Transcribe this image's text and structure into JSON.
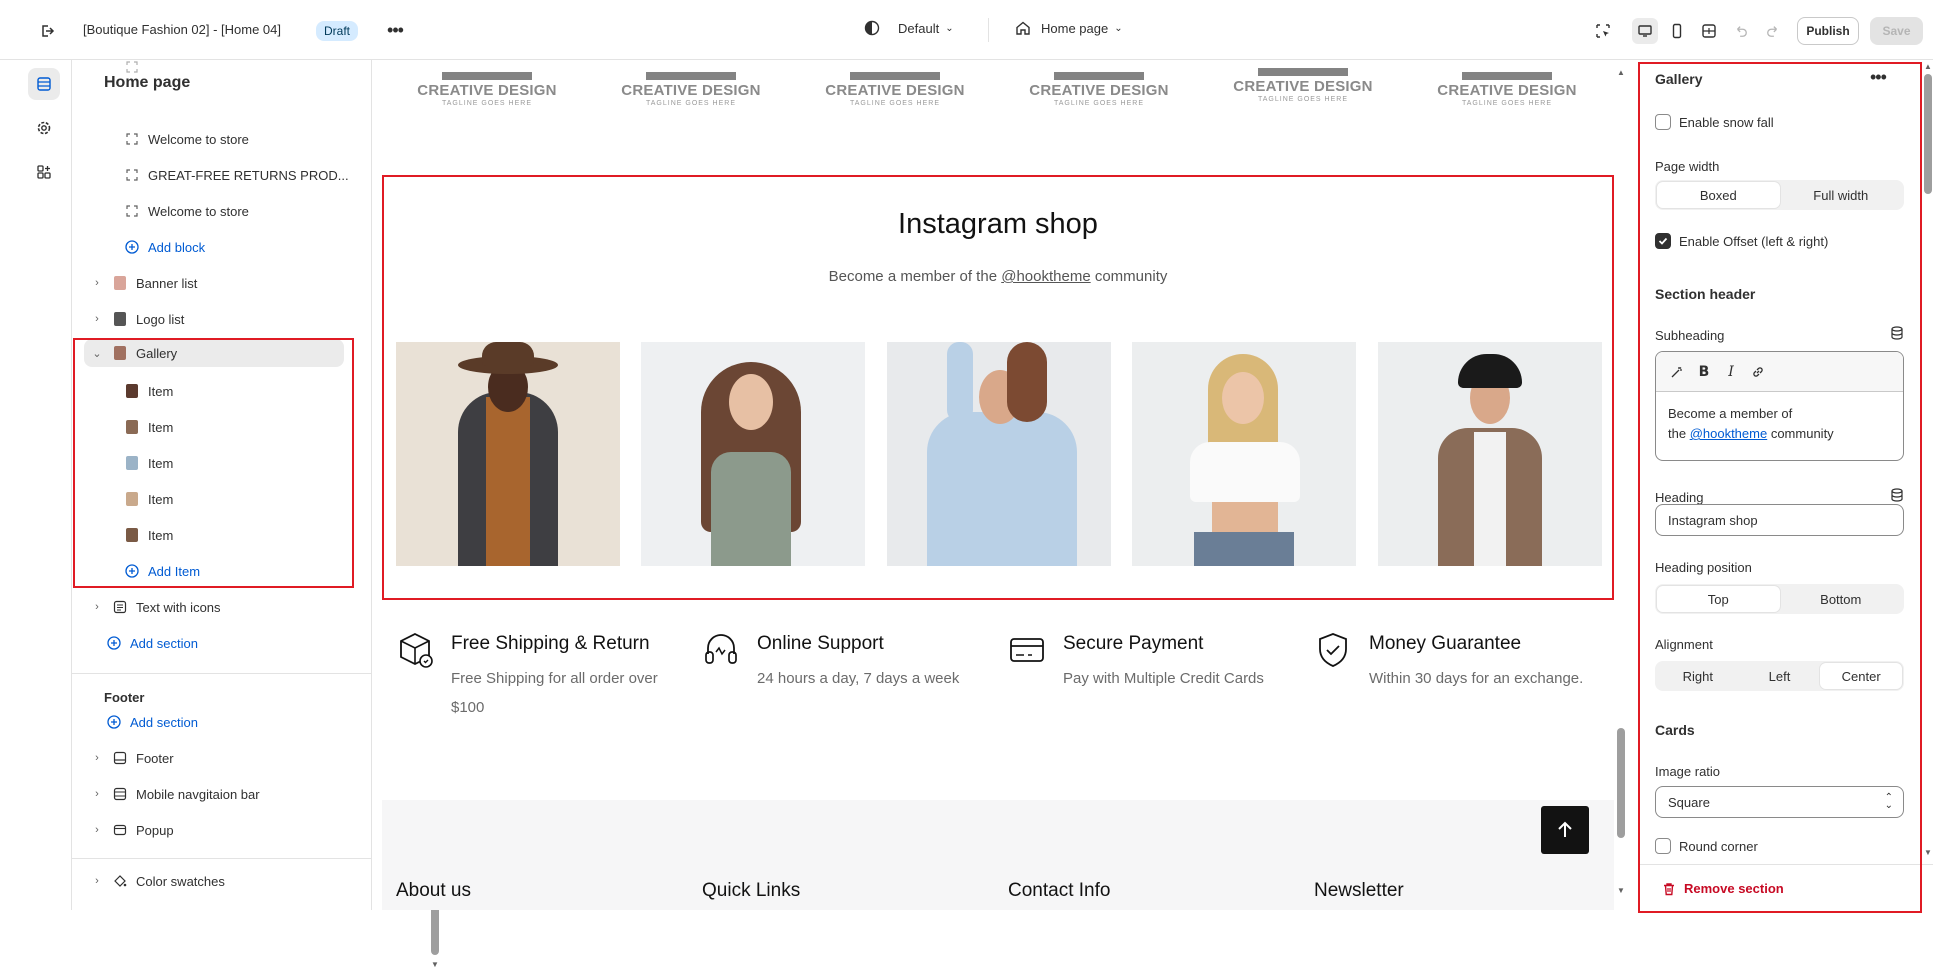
{
  "topbar": {
    "title": "[Boutique Fashion 02] - [Home 04]",
    "badge": "Draft",
    "theme_label": "Default",
    "page_label": "Home page",
    "publish_label": "Publish",
    "save_label": "Save"
  },
  "left_panel": {
    "title": "Home page",
    "items": [
      {
        "label": "Welcome to store"
      },
      {
        "label": "GREAT-FREE RETURNS PROD..."
      },
      {
        "label": "Welcome to store"
      }
    ],
    "add_block": "Add block",
    "sections": [
      {
        "label": "Banner list"
      },
      {
        "label": "Logo list"
      },
      {
        "label": "Gallery"
      }
    ],
    "gallery_items": [
      "Item",
      "Item",
      "Item",
      "Item",
      "Item"
    ],
    "add_item": "Add Item",
    "text_with_icons": "Text with icons",
    "add_section": "Add section",
    "footer_label": "Footer",
    "footer_add_section": "Add section",
    "footer_sections": [
      {
        "label": "Footer"
      },
      {
        "label": "Mobile navgitaion bar"
      },
      {
        "label": "Popup"
      }
    ],
    "color_swatches": "Color swatches"
  },
  "preview": {
    "logos": [
      {
        "text": "CREATIVE DESIGN",
        "tag": "TAGLINE GOES HERE"
      },
      {
        "text": "CREATIVE DESIGN",
        "tag": "TAGLINE GOES HERE"
      },
      {
        "text": "CREATIVE DESIGN",
        "tag": "TAGLINE GOES HERE"
      },
      {
        "text": "CREATIVE DESIGN",
        "tag": "TAGLINE GOES HERE"
      },
      {
        "text": "CREATIVE DESIGN",
        "tag": "TAGLINE GOES HERE"
      },
      {
        "text": "CREATIVE DESIGN",
        "tag": "TAGLINE GOES HERE"
      }
    ],
    "instagram_title": "Instagram shop",
    "instagram_sub_before": "Become a member of the ",
    "instagram_handle": "@hooktheme",
    "instagram_sub_after": " community",
    "features": [
      {
        "title": "Free Shipping & Return",
        "desc": "Free Shipping for all order over $100",
        "icon": "box-icon"
      },
      {
        "title": "Online Support",
        "desc": "24 hours a day, 7 days a week",
        "icon": "headset-icon"
      },
      {
        "title": "Secure Payment",
        "desc": "Pay with Multiple Credit Cards",
        "icon": "card-icon"
      },
      {
        "title": "Money Guarantee",
        "desc": "Within 30 days for an exchange.",
        "icon": "shield-icon"
      }
    ],
    "footer_headings": [
      "About us",
      "Quick Links",
      "Contact Info",
      "Newsletter"
    ]
  },
  "right_panel": {
    "title": "Gallery",
    "enable_snow": "Enable snow fall",
    "page_width_label": "Page width",
    "page_width_options": [
      "Boxed",
      "Full width"
    ],
    "enable_offset": "Enable Offset (left & right)",
    "section_header": "Section header",
    "subheading_label": "Subheading",
    "subheading_text_1": "Become a member of",
    "subheading_text_2_before": "the ",
    "subheading_link": "@hooktheme",
    "subheading_text_2_after": " community",
    "heading_label": "Heading",
    "heading_value": "Instagram shop",
    "heading_position_label": "Heading position",
    "heading_position_options": [
      "Top",
      "Bottom"
    ],
    "alignment_label": "Alignment",
    "alignment_options": [
      "Right",
      "Left",
      "Center"
    ],
    "cards_label": "Cards",
    "image_ratio_label": "Image ratio",
    "image_ratio_value": "Square",
    "round_corner": "Round corner",
    "remove_section": "Remove section"
  },
  "colors": {
    "highlight": "#e01b24",
    "link": "#005bd3",
    "danger": "#c70a24"
  }
}
